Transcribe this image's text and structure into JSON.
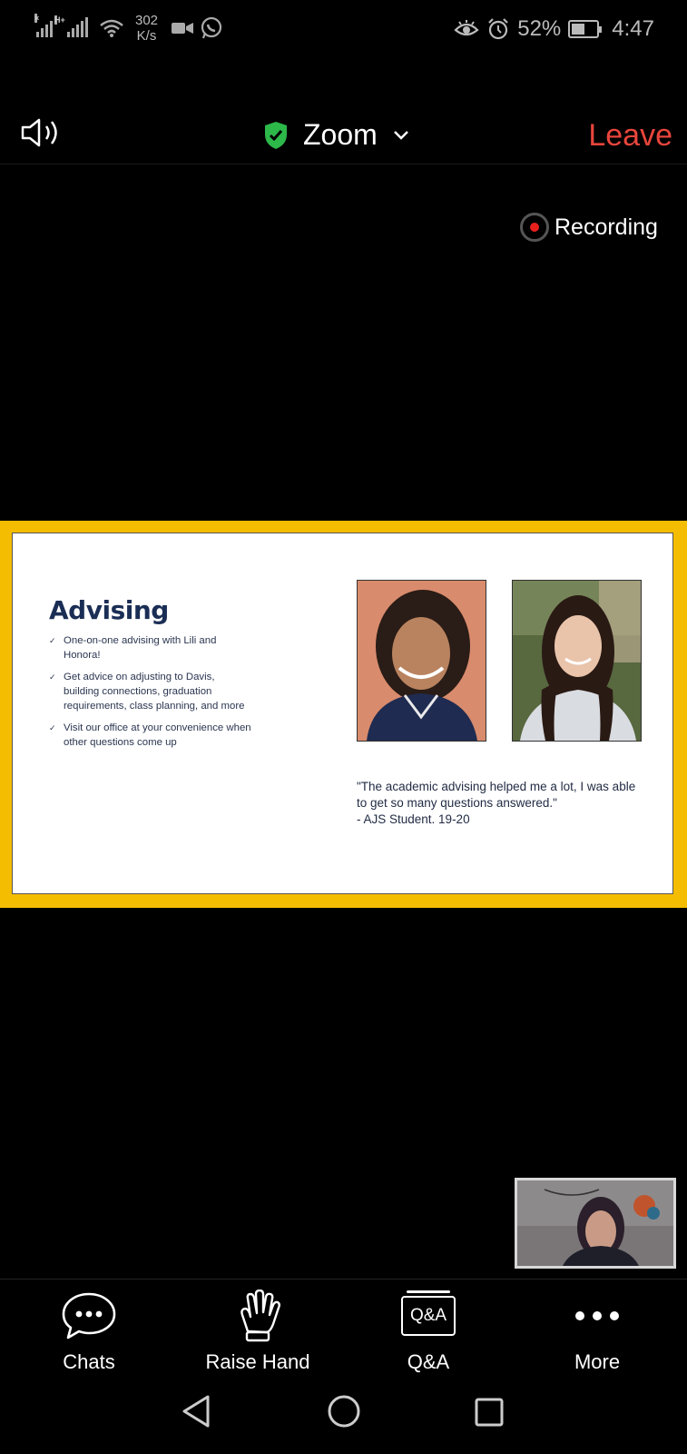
{
  "status_bar": {
    "network_type": "H+",
    "speed_value": "302",
    "speed_unit": "K/s",
    "battery_percent": "52%",
    "battery_level": 0.52,
    "time": "4:47"
  },
  "top_bar": {
    "meeting_title": "Zoom",
    "leave_label": "Leave",
    "security_color": "#2db84a",
    "leave_color": "#e8453c"
  },
  "recording_label": "Recording",
  "slide": {
    "title": "Advising",
    "bullets": [
      "One-on-one advising with Lili and Honora!",
      "Get advice on adjusting to Davis, building connections, graduation requirements, class planning, and more",
      "Visit our office at your convenience when other questions come up"
    ],
    "quote": "\"The academic advising helped me a lot, I was able to get so many questions answered.\"",
    "quote_attribution": "- AJS Student. 19-20",
    "frame_color": "#f5bd02"
  },
  "toolbar": {
    "chats_label": "Chats",
    "raise_hand_label": "Raise Hand",
    "qa_label": "Q&A",
    "qa_icon_text": "Q&A",
    "more_label": "More"
  },
  "icons": {
    "audio": "speaker-icon",
    "security": "shield-check-icon",
    "chats": "chat-bubble-icon",
    "raise_hand": "hand-icon",
    "qa": "qa-icon",
    "more": "more-dots-icon"
  }
}
